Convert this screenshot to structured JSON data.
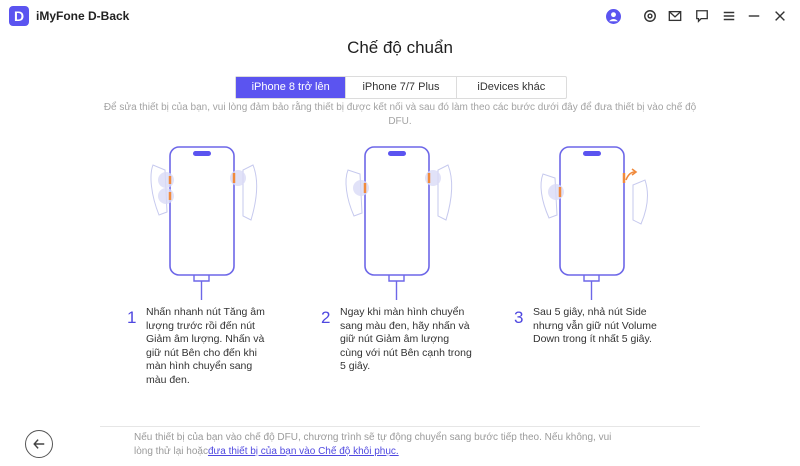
{
  "app": {
    "logo_letter": "D",
    "name": "iMyFone D-Back"
  },
  "titlebar_icons": [
    "user-icon",
    "settings-icon",
    "mail-icon",
    "feedback-icon",
    "menu-icon",
    "minimize-icon",
    "close-icon"
  ],
  "page": {
    "title": "Chế độ chuẩn",
    "subtitle": "Để sửa thiết bị của bạn, vui lòng đảm bảo rằng thiết bị được kết nối và sau đó làm theo các bước dưới đây để đưa thiết bị vào chế độ DFU."
  },
  "tabs": [
    {
      "label": "iPhone 8 trở lên",
      "active": true
    },
    {
      "label": "iPhone 7/7 Plus",
      "active": false
    },
    {
      "label": "iDevices khác",
      "active": false
    }
  ],
  "steps": [
    {
      "number": "1",
      "text": "Nhấn nhanh nút Tăng âm lượng trước rồi đến nút Giảm âm lượng. Nhấn và giữ nút Bên cho đến khi màn hình chuyển sang màu đen."
    },
    {
      "number": "2",
      "text": "Ngay khi màn hình chuyển sang màu đen, hãy nhấn và giữ nút Giảm âm lượng cùng với nút Bên cạnh trong 5 giây."
    },
    {
      "number": "3",
      "text": "Sau 5 giây, nhả nút Side nhưng vẫn giữ nút Volume Down trong ít nhất 5 giây."
    }
  ],
  "footer": {
    "text": "Nếu thiết bị của bạn vào chế độ DFU, chương trình sẽ tự động chuyển sang bước tiếp theo. Nếu không, vui lòng thử lại hoặc",
    "link": "đưa thiết bị của bạn vào Chế độ khôi phục."
  },
  "colors": {
    "accent": "#5b54f0",
    "button_highlight": "#f08a3c"
  }
}
